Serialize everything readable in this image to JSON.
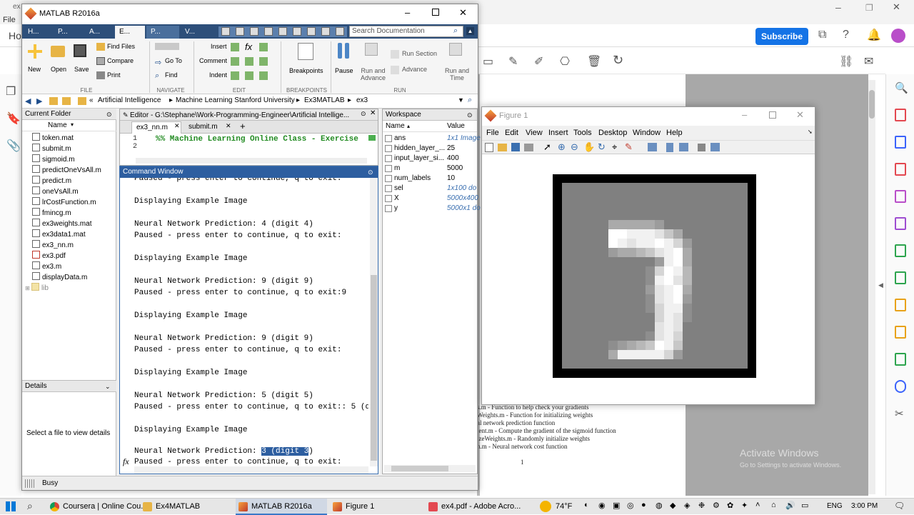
{
  "background_app": {
    "menu_file": "File",
    "tab_prefix": "ex",
    "home_tab": "Ho",
    "subscribe_label": "Subscribe",
    "pdf_lines": [
      "s.m - Function to help check your gradients",
      "Weights.m - Function for initializing weights",
      "al network prediction function",
      "ient.m - Compute the gradient of the sigmoid function",
      "izeWeights.m - Randomly initialize weights",
      "n.m - Neural network cost function"
    ],
    "page_number": "1",
    "watermark_line1": "Activate Windows",
    "watermark_line2": "Go to Settings to activate Windows."
  },
  "matlab": {
    "title": "MATLAB R2016a",
    "tabs": [
      "H...",
      "P...",
      "A...",
      "E...",
      "P...",
      "V..."
    ],
    "search_placeholder": "Search Documentation",
    "ribbon": {
      "new": "New",
      "open": "Open",
      "save": "Save",
      "find_files": "Find Files",
      "compare": "Compare",
      "print": "Print",
      "go_to": "Go To",
      "find": "Find",
      "insert": "Insert",
      "comment": "Comment",
      "indent": "Indent",
      "breakpoints": "Breakpoints",
      "pause": "Pause",
      "run_and_advance": "Run and\nAdvance",
      "run_section": "Run Section",
      "advance": "Advance",
      "run_and_time": "Run and\nTime",
      "sec_file": "FILE",
      "sec_navigate": "NAVIGATE",
      "sec_edit": "EDIT",
      "sec_breakpoints": "BREAKPOINTS",
      "sec_run": "RUN"
    },
    "path": [
      "Artificial Intelligence",
      "Machine Learning Stanford University",
      "Ex3MATLAB",
      "ex3"
    ],
    "current_folder": {
      "title": "Current Folder",
      "col_name": "Name",
      "files": [
        "token.mat",
        "submit.m",
        "sigmoid.m",
        "predictOneVsAll.m",
        "predict.m",
        "oneVsAll.m",
        "lrCostFunction.m",
        "fmincg.m",
        "ex3weights.mat",
        "ex3data1.mat",
        "ex3_nn.m",
        "ex3.pdf",
        "ex3.m",
        "displayData.m",
        "lib"
      ]
    },
    "details": {
      "title": "Details",
      "placeholder": "Select a file to view details"
    },
    "editor": {
      "title": "Editor - G:\\Stephane\\Work-Programming-Engineer\\Artificial Intellige...",
      "tabs": [
        "ex3_nn.m",
        "submit.m"
      ],
      "line1_num": "1",
      "line2_num": "2",
      "line1_code": "%% Machine Learning Online Class - Exercise"
    },
    "command_window": {
      "title": "Command Window",
      "lines": [
        "Paused - press enter to continue, q to exit:",
        "",
        "Displaying Example Image",
        "",
        "Neural Network Prediction: 4 (digit 4)",
        "Paused - press enter to continue, q to exit:",
        "",
        "Displaying Example Image",
        "",
        "Neural Network Prediction: 9 (digit 9)",
        "Paused - press enter to continue, q to exit:9",
        "",
        "Displaying Example Image",
        "",
        "Neural Network Prediction: 9 (digit 9)",
        "Paused - press enter to continue, q to exit:",
        "",
        "Displaying Example Image",
        "",
        "Neural Network Prediction: 5 (digit 5)",
        "Paused - press enter to continue, q to exit:: 5 (d",
        "",
        "Displaying Example Image",
        ""
      ],
      "last_prefix": "Neural Network Prediction: ",
      "last_selected": "3 (digit 3",
      "last_suffix": ")",
      "prompt_line": "Paused - press enter to continue, q to exit:",
      "fx": "fx"
    },
    "workspace": {
      "title": "Workspace",
      "col_name": "Name",
      "col_value": "Value",
      "vars": [
        {
          "name": "ans",
          "value": "1x1 Image"
        },
        {
          "name": "hidden_layer_...",
          "value": "25"
        },
        {
          "name": "input_layer_si...",
          "value": "400"
        },
        {
          "name": "m",
          "value": "5000"
        },
        {
          "name": "num_labels",
          "value": "10"
        },
        {
          "name": "sel",
          "value": "1x100 do"
        },
        {
          "name": "X",
          "value": "5000x400"
        },
        {
          "name": "y",
          "value": "5000x1 do"
        }
      ]
    },
    "status": "Busy"
  },
  "figure": {
    "title": "Figure 1",
    "menus": [
      "File",
      "Edit",
      "View",
      "Insert",
      "Tools",
      "Desktop",
      "Window",
      "Help"
    ],
    "digit_rows": [
      "00000000000000000000",
      "00000000000000000000",
      "00000000000000000000",
      "00000000000000000000",
      "00000333332000000000",
      "00000998887530000000",
      "00000987889862000000",
      "00000233457893000000",
      "00000000002893000000",
      "00000000016984000000",
      "00000000018974000000",
      "00000000027893000000",
      "00000000017892000000",
      "00000000016881000000",
      "00000000006871000000",
      "00000000007870000000",
      "00000000017860000000",
      "00000123459850000000",
      "00000388888620000000",
      "00000000000000000000"
    ]
  },
  "taskbar": {
    "items": [
      "Coursera | Online Cou...",
      "Ex4MATLAB",
      "MATLAB R2016a",
      "Figure 1",
      "ex4.pdf - Adobe Acro..."
    ],
    "weather": "74°F",
    "language": "ENG",
    "time": "3:00 PM"
  }
}
